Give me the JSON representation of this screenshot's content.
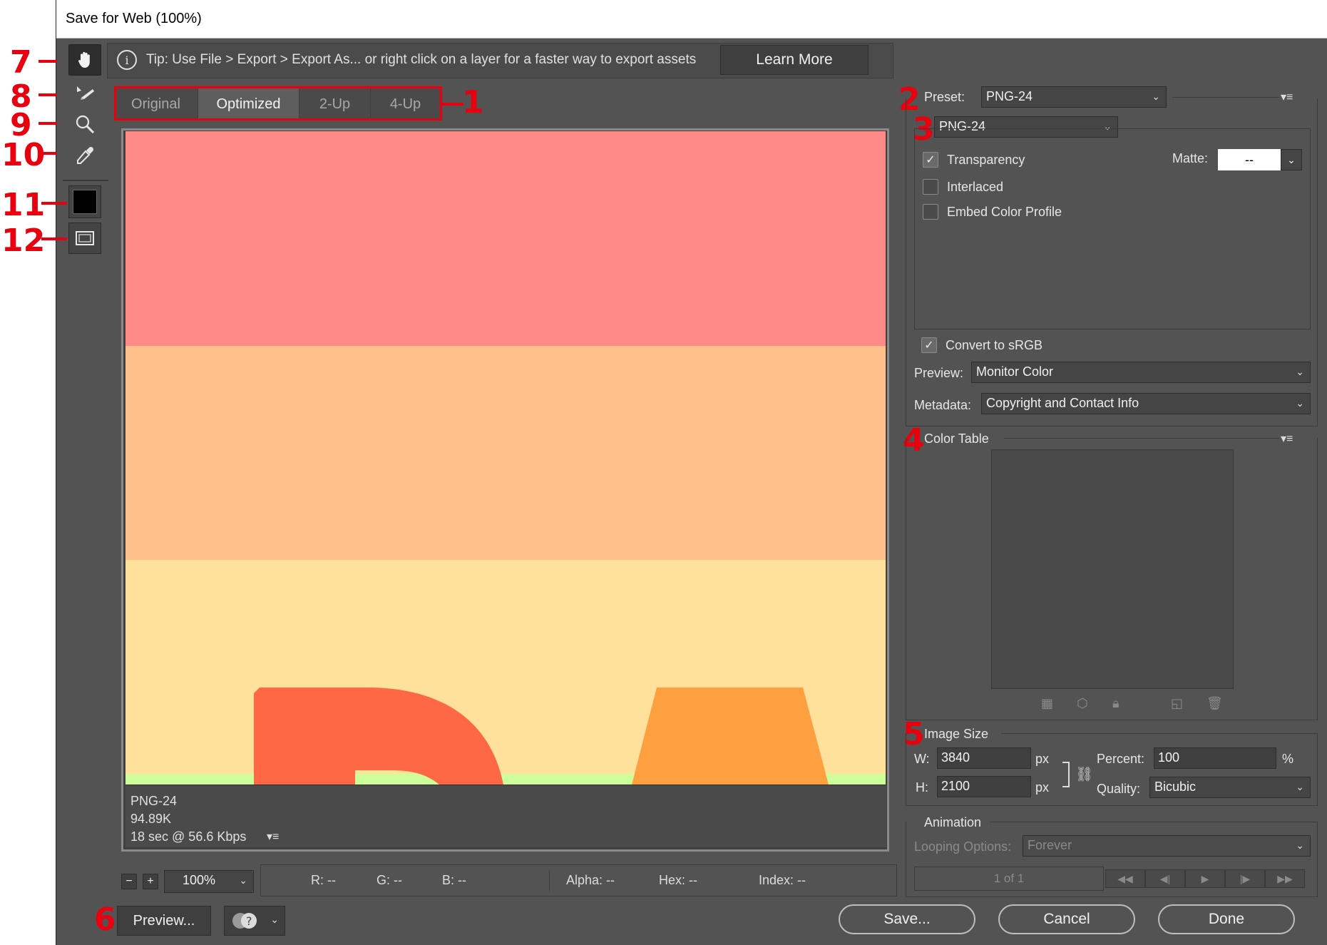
{
  "window": {
    "title": "Save for Web (100%)"
  },
  "annotations": [
    "1",
    "2",
    "3",
    "4",
    "5",
    "6",
    "7",
    "8",
    "9",
    "10",
    "11",
    "12"
  ],
  "tip": {
    "text": "Tip: Use File > Export > Export As...  or right click on a layer for a faster way to export assets",
    "learn_more": "Learn More"
  },
  "tabs": [
    "Original",
    "Optimized",
    "2-Up",
    "4-Up"
  ],
  "preview_info": {
    "format": "PNG-24",
    "size": "94.89K",
    "speed": "18 sec @ 56.6 Kbps"
  },
  "zoom": {
    "value": "100%"
  },
  "status": {
    "r": "R: --",
    "g": "G: --",
    "b": "B: --",
    "alpha": "Alpha: --",
    "hex": "Hex: --",
    "index": "Index: --"
  },
  "settings": {
    "preset_label": "Preset:",
    "preset_value": "PNG-24",
    "format_value": "PNG-24",
    "transparency": "Transparency",
    "matte_label": "Matte:",
    "matte_value": "--",
    "interlaced": "Interlaced",
    "embed_profile": "Embed Color Profile",
    "convert_srgb": "Convert to sRGB",
    "preview_label": "Preview:",
    "preview_value": "Monitor Color",
    "metadata_label": "Metadata:",
    "metadata_value": "Copyright and Contact Info"
  },
  "color_table": {
    "title": "Color Table"
  },
  "image_size": {
    "title": "Image Size",
    "w_label": "W:",
    "w_value": "3840",
    "h_label": "H:",
    "h_value": "2100",
    "unit": "px",
    "percent_label": "Percent:",
    "percent_value": "100",
    "percent_unit": "%",
    "quality_label": "Quality:",
    "quality_value": "Bicubic"
  },
  "animation": {
    "title": "Animation",
    "looping_label": "Looping Options:",
    "looping_value": "Forever",
    "frame": "1 of 1"
  },
  "buttons": {
    "preview": "Preview...",
    "save": "Save...",
    "cancel": "Cancel",
    "done": "Done"
  },
  "colors": {
    "stripe1": "#ff8a88",
    "stripe2": "#ffc08c",
    "stripe3": "#ffe19c",
    "shape_red": "#ff6845",
    "shape_orange": "#ffa040",
    "green": "#ccff99",
    "foreground": "#000000"
  }
}
